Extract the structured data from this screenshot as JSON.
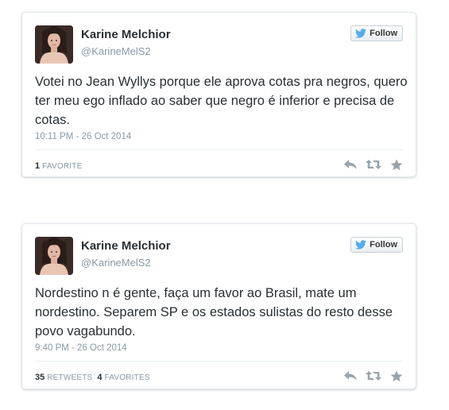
{
  "tweets": [
    {
      "name": "Karine Melchior",
      "handle": "@KarineMelS2",
      "follow_label": "Follow",
      "text": "Votei no Jean Wyllys porque ele aprova cotas pra negros, quero ter meu ego inflado ao saber que negro é inferior e precisa de cotas.",
      "timestamp": "10:11 PM - 26 Oct 2014",
      "favorites_count": "1",
      "favorites_label": "FAVORITE"
    },
    {
      "name": "Karine Melchior",
      "handle": "@KarineMelS2",
      "follow_label": "Follow",
      "text": "Nordestino n é gente, faça um favor ao Brasil, mate um nordestino. Separem SP e os estados sulistas do resto desse povo vagabundo.",
      "timestamp": "9:40 PM - 26 Oct 2014",
      "retweets_count": "35",
      "retweets_label": "RETWEETS",
      "favorites_count": "4",
      "favorites_label": "FAVORITES"
    }
  ],
  "icons": {
    "follow": "twitter-bird-icon",
    "reply": "reply-icon",
    "retweet": "retweet-icon",
    "favorite": "star-icon"
  },
  "colors": {
    "name": "#292f33",
    "muted": "#8899a6",
    "bird": "#55acee",
    "action_icon": "#9aa4ab",
    "card_border": "#e1e8ed"
  }
}
